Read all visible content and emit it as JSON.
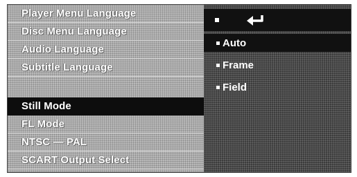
{
  "menu": {
    "items": [
      {
        "label": "Player Menu Language"
      },
      {
        "label": "Disc Menu Language"
      },
      {
        "label": "Audio Language"
      },
      {
        "label": "Subtitle Language"
      },
      {
        "label": "Still Mode",
        "selected": true
      },
      {
        "label": "FL Mode"
      },
      {
        "label": "NTSC — PAL"
      },
      {
        "label": "SCART Output Select"
      }
    ]
  },
  "options": {
    "header_icon": "return-arrow-icon",
    "items": [
      {
        "label": "Auto",
        "selected": true
      },
      {
        "label": "Frame"
      },
      {
        "label": "Field"
      }
    ]
  },
  "colors": {
    "highlight": "#111111",
    "text": "#ffffff"
  }
}
